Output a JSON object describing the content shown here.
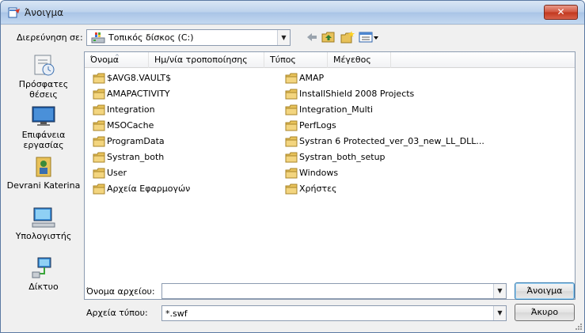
{
  "window": {
    "title": "Άνοιγμα",
    "close_label": "✕"
  },
  "toolbar": {
    "lookin_label": "Διερεύνηση σε:",
    "lookin_value": "Τοπικός δίσκος (C:)"
  },
  "places": [
    {
      "label": "Πρόσφατες θέσεις",
      "icon": "recent-places-icon"
    },
    {
      "label": "Επιφάνεια εργασίας",
      "icon": "desktop-icon"
    },
    {
      "label": "Devrani Katerina",
      "icon": "user-folder-icon"
    },
    {
      "label": "Υπολογιστής",
      "icon": "computer-icon"
    },
    {
      "label": "Δίκτυο",
      "icon": "network-icon"
    }
  ],
  "columns": {
    "name": "Όνομα",
    "date": "Ημ/νία τροποποίησης",
    "type": "Τύπος",
    "size": "Μέγεθος"
  },
  "files_left": [
    "$AVG8.VAULT$",
    "AMAPACTIVITY",
    "Integration",
    "MSOCache",
    "ProgramData",
    "Systran_both",
    "User",
    "Αρχεία Εφαρμογών"
  ],
  "files_right": [
    "AMAP",
    "InstallShield 2008 Projects",
    "Integration_Multi",
    "PerfLogs",
    "Systran 6 Protected_ver_03_new_LL_DLL...",
    "Systran_both_setup",
    "Windows",
    "Χρήστες"
  ],
  "filename": {
    "label": "Όνομα αρχείου:",
    "value": ""
  },
  "filetype": {
    "label": "Αρχεία τύπου:",
    "value": "*.swf"
  },
  "buttons": {
    "open": "Άνοιγμα",
    "cancel": "Άκυρο"
  },
  "colors": {
    "folder": "#e8c25a",
    "close": "#c1371d"
  }
}
